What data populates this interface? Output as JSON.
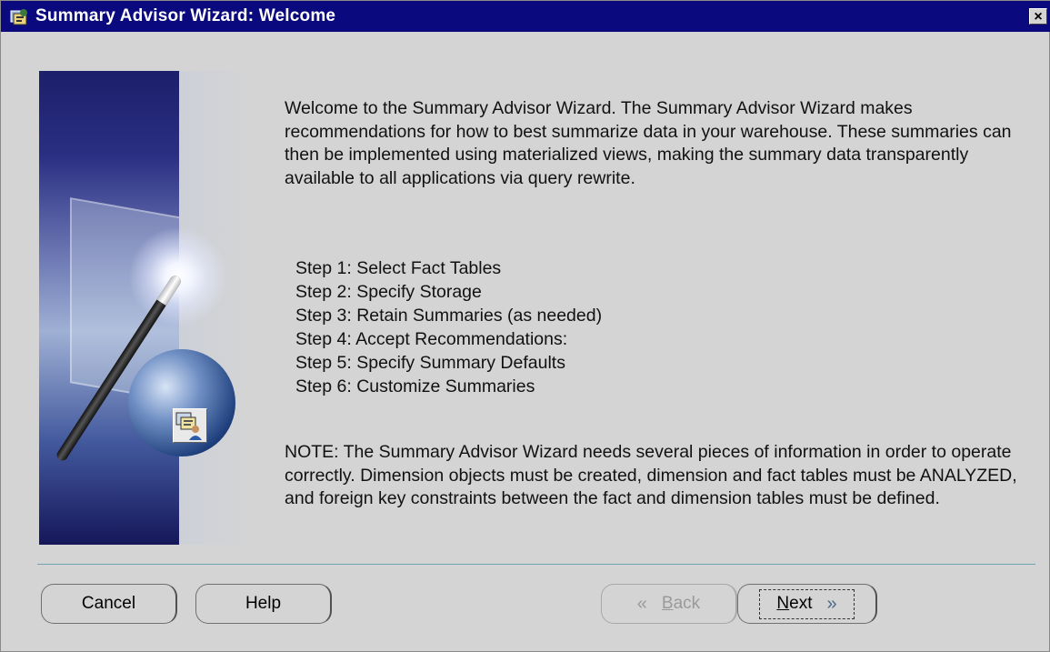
{
  "window": {
    "title": "Summary Advisor Wizard: Welcome",
    "close_glyph": "×",
    "app_icon": "wizard-app-icon"
  },
  "content": {
    "intro": "Welcome to the Summary Advisor Wizard.  The Summary Advisor Wizard makes recommendations for how to best summarize data in your warehouse.  These summaries can then be implemented using materialized views, making the summary data transparently available to all applications via query rewrite.",
    "steps": [
      "Step 1: Select Fact Tables",
      "Step 2: Specify Storage",
      "Step 3: Retain Summaries (as needed)",
      "Step 4: Accept Recommendations:",
      "Step 5: Specify Summary Defaults",
      "Step 6: Customize Summaries"
    ],
    "note": "NOTE:  The Summary Advisor Wizard needs several pieces of information in order to operate correctly.  Dimension objects must be created, dimension and fact tables must be ANALYZED, and foreign key constraints between the fact and dimension tables must be defined."
  },
  "buttons": {
    "cancel": "Cancel",
    "help": "Help",
    "back_mnemonic": "B",
    "back_rest": "ack",
    "back_icon": "chevron-left-double-icon",
    "next_mnemonic": "N",
    "next_rest": "ext",
    "next_icon": "chevron-right-double-icon"
  },
  "colors": {
    "titlebar": "#0a0a7e",
    "dialog_bg": "#d4d4d4",
    "divider": "#6fa3ad",
    "disabled_text": "#9a9a9a"
  }
}
